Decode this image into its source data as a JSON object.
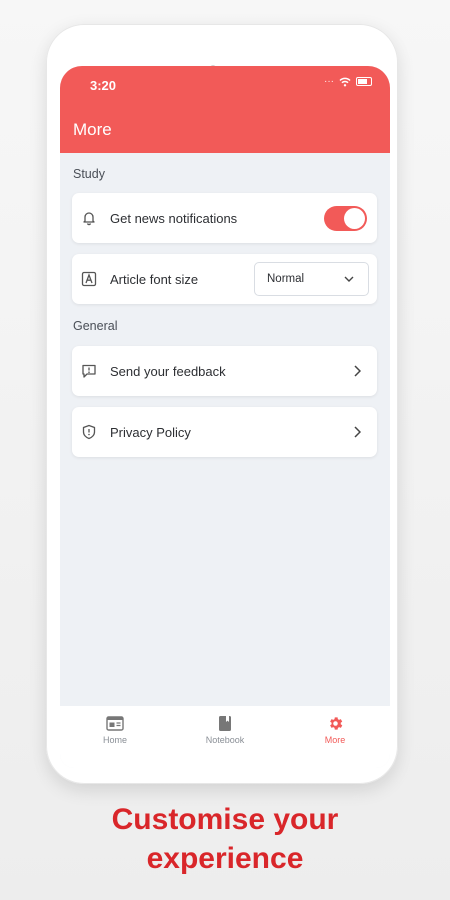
{
  "status_bar": {
    "time": "3:20"
  },
  "app_bar": {
    "title": "More"
  },
  "sections": {
    "study": "Study",
    "general": "General"
  },
  "settings": {
    "notifications_label": "Get news notifications",
    "notifications_enabled": true,
    "font_size_label": "Article font size",
    "font_size_value": "Normal",
    "feedback_label": "Send your feedback",
    "privacy_label": "Privacy Policy"
  },
  "bottom_nav": {
    "home": "Home",
    "notebook": "Notebook",
    "more": "More",
    "active": "more"
  },
  "tagline": {
    "line1": "Customise your",
    "line2": "experience"
  },
  "colors": {
    "accent": "#f25a58",
    "tagline": "#d9262a",
    "screen_bg": "#eef1f5"
  },
  "icons": {
    "notifications": "bell-icon",
    "font_size": "font-size-icon",
    "feedback": "feedback-icon",
    "privacy": "shield-icon",
    "home": "home-icon",
    "notebook": "notebook-icon",
    "more": "gear-icon"
  }
}
